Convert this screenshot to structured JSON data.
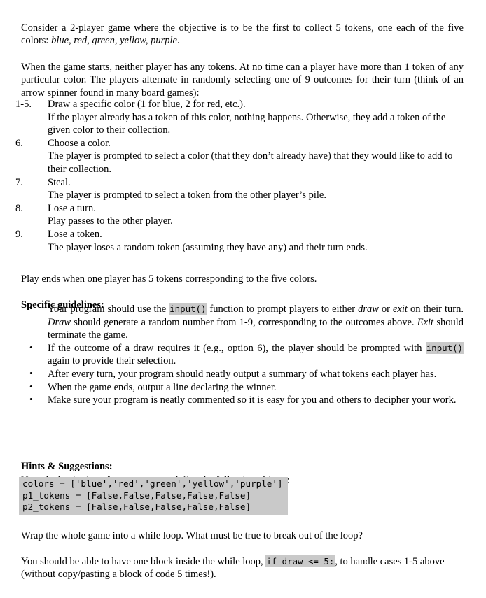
{
  "document": {
    "intro": {
      "para1_before": "Consider a 2-player game where the objective is to be the first to collect 5 tokens, one each of the five colors: ",
      "para1_colors": "blue, red, green, yellow, purple",
      "para1_after": ".",
      "para2": "When the game starts, neither player has any tokens. At no time can a player have more than 1 token of any particular color. The players alternate in randomly selecting one of 9 outcomes for their turn (think of an arrow spinner found in many board games):"
    },
    "outcomes": [
      {
        "number": "1-5.",
        "title": "Draw a specific color (1 for blue, 2 for red, etc.).",
        "detail": "If the player already has a token of this color, nothing happens. Otherwise, they add a token of the given color to their collection."
      },
      {
        "number": "6.",
        "title": "Choose a color.",
        "detail": "The player is prompted to select a color (that they don’t already have) that they would like to add to their collection."
      },
      {
        "number": "7.",
        "title": "Steal.",
        "detail": "The player is prompted to select a token from the other player’s pile."
      },
      {
        "number": "8.",
        "title": "Lose a turn.",
        "detail": "Play passes to the other player."
      },
      {
        "number": "9.",
        "title": "Lose a token.",
        "detail": "The player loses a random token (assuming they have any) and their turn ends."
      }
    ],
    "play_ends": "Play ends when one player has 5 tokens corresponding to the five colors.",
    "guidelines": {
      "heading": "Specific guidelines:",
      "bullets": [
        {
          "seg1": "Your program should use the ",
          "code1": "input()",
          "seg2": " function to prompt players to either ",
          "em1": "draw",
          "seg3": " or ",
          "em2": "exit",
          "seg4": " on their turn. ",
          "em3": "Draw",
          "seg5": " should generate a random number from 1-9, corresponding to the outcomes above. ",
          "em4": "Exit",
          "seg6": " should terminate the game."
        },
        {
          "seg1": "If the outcome of a draw requires it (e.g., option 6), the player should be prompted with ",
          "code1": "input()",
          "seg2": " again to provide their selection."
        },
        {
          "seg1": "After every turn, your program should neatly output a summary of what tokens each player has."
        },
        {
          "seg1": "When the game ends, output a line declaring the winner."
        },
        {
          "seg1": "Make sure your program is neatly commented so it is easy for you and others to decipher your work."
        }
      ]
    },
    "hints": {
      "heading": "Hints & Suggestions:",
      "lead": "Near the beginning of your program, define the following objects:",
      "code_lines": [
        "colors = ['blue','red','green','yellow','purple']",
        "p1_tokens = [False,False,False,False,False]",
        "p2_tokens = [False,False,False,False,False]"
      ],
      "para_while": "Wrap the whole game into a while loop. What must be true to break out of the loop?",
      "para_block_before": "You should be able to have one block inside the while loop, ",
      "para_block_code": "if draw <= 5:",
      "para_block_after": ", to handle cases 1-5 above (without copy/pasting a block of code 5 times!)."
    },
    "style": {
      "highlight_gray": "#c9c9c9",
      "text_color": "#000000",
      "page_background": "#ffffff"
    }
  }
}
